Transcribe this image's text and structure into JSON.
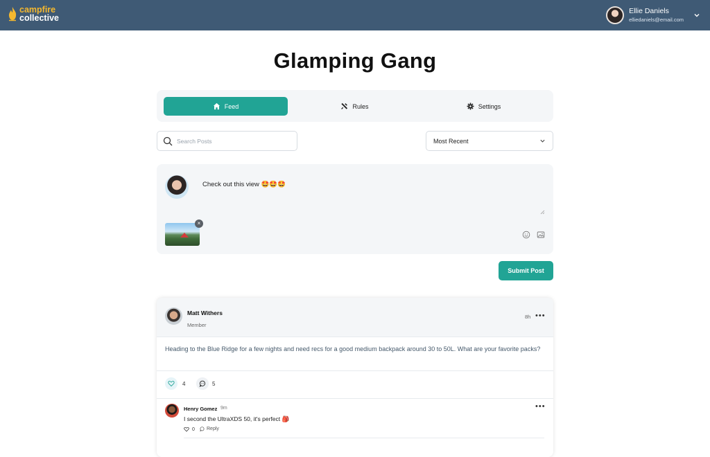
{
  "brand": {
    "line1": "campfire",
    "line2": "collective"
  },
  "user": {
    "name": "Ellie Daniels",
    "email": "elliedaniels@email.com"
  },
  "group": {
    "title": "Glamping Gang"
  },
  "tabs": [
    {
      "label": "Feed",
      "icon": "home-icon",
      "active": true
    },
    {
      "label": "Rules",
      "icon": "tools-icon",
      "active": false
    },
    {
      "label": "Settings",
      "icon": "gear-icon",
      "active": false
    }
  ],
  "search": {
    "placeholder": "Search Posts",
    "value": ""
  },
  "sort": {
    "selected": "Most Recent"
  },
  "composer": {
    "text": "Check out this view 🤩🤩🤩",
    "attachment_close": "×"
  },
  "submit_label": "Submit Post",
  "colors": {
    "accent": "#21a495",
    "topbar": "#3f5a75",
    "brand_orange": "#f5b82e"
  },
  "post": {
    "author": "Matt Withers",
    "role": "Member",
    "time": "8h",
    "more": "•••",
    "body": "Heading to the Blue Ridge for a few nights and need recs for a good medium backpack around 30 to 50L. What are your favorite packs?",
    "likes": "4",
    "comments": "5"
  },
  "comment": {
    "author": "Henry Gomez",
    "time": "9m",
    "text": "I second the UltraXDS 50, it's perfect 🎒",
    "likes": "0",
    "reply_label": "Reply",
    "more": "•••"
  }
}
